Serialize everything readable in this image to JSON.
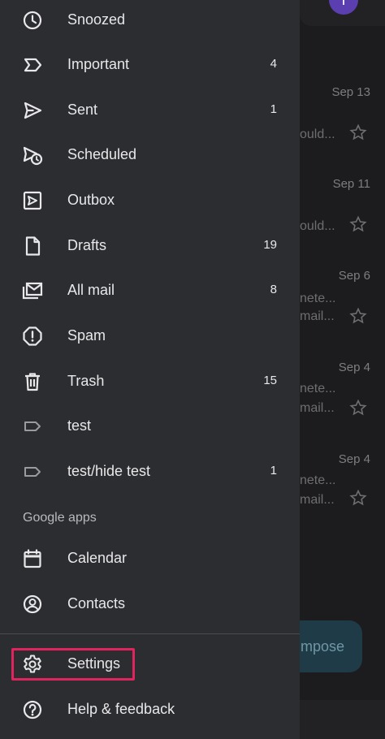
{
  "drawer": {
    "items": [
      {
        "label": "Snoozed",
        "count": "",
        "icon": "clock-icon"
      },
      {
        "label": "Important",
        "count": "4",
        "icon": "important-icon"
      },
      {
        "label": "Sent",
        "count": "1",
        "icon": "send-icon"
      },
      {
        "label": "Scheduled",
        "count": "",
        "icon": "scheduled-send-icon"
      },
      {
        "label": "Outbox",
        "count": "",
        "icon": "outbox-icon"
      },
      {
        "label": "Drafts",
        "count": "19",
        "icon": "draft-icon"
      },
      {
        "label": "All mail",
        "count": "8",
        "icon": "all-mail-icon"
      },
      {
        "label": "Spam",
        "count": "",
        "icon": "spam-icon"
      },
      {
        "label": "Trash",
        "count": "15",
        "icon": "trash-icon"
      },
      {
        "label": "test",
        "count": "",
        "icon": "label-icon"
      },
      {
        "label": "test/hide test",
        "count": "1",
        "icon": "label-icon"
      }
    ],
    "google_apps_label": "Google apps",
    "apps": [
      {
        "label": "Calendar",
        "icon": "calendar-icon"
      },
      {
        "label": "Contacts",
        "icon": "contacts-icon"
      }
    ],
    "footer": [
      {
        "label": "Settings",
        "icon": "gear-icon",
        "highlighted": true
      },
      {
        "label": "Help & feedback",
        "icon": "help-icon"
      }
    ]
  },
  "background": {
    "dates": [
      "Sep 13",
      "Sep 11",
      "Sep 6",
      "Sep 4",
      "Sep 4"
    ],
    "snippets": [
      [
        "ould..."
      ],
      [
        "ould..."
      ],
      [
        "nete...",
        "mail..."
      ],
      [
        "nete...",
        "mail..."
      ],
      [
        "nete...",
        "mail..."
      ]
    ],
    "compose_label": "mpose"
  },
  "colors": {
    "drawer_bg": "#2c2d30",
    "text": "#e8e8ea",
    "highlight": "#e0245e"
  }
}
